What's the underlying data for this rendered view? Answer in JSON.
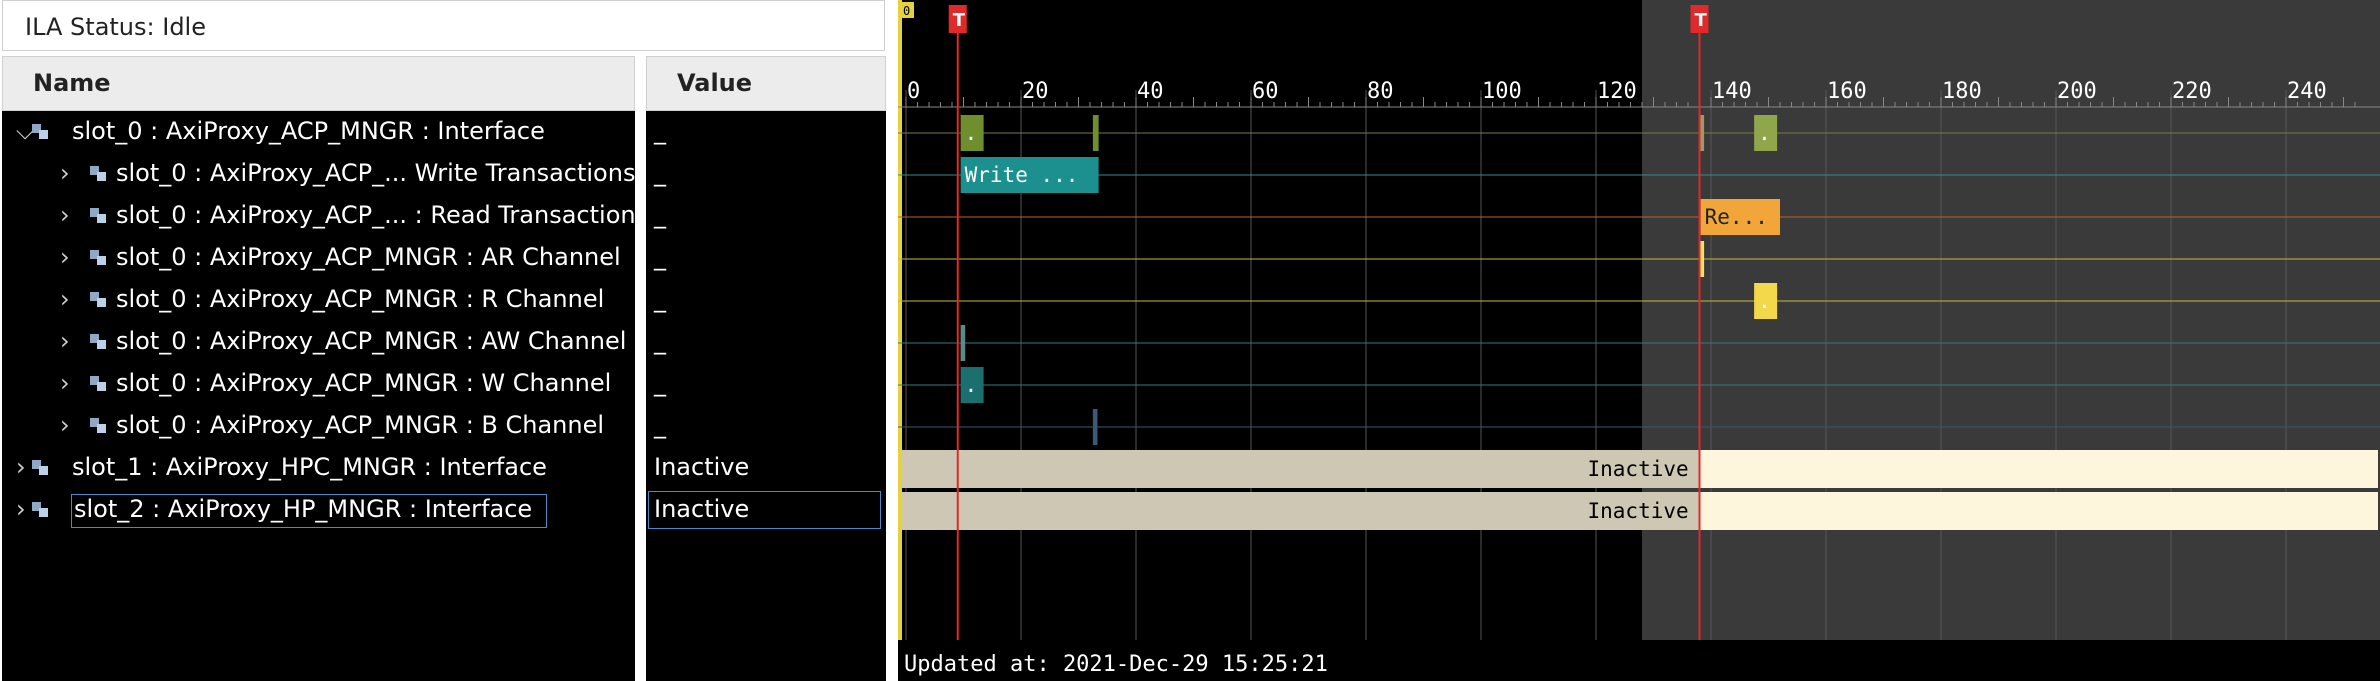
{
  "ila_status": "ILA Status: Idle",
  "columns": {
    "name": "Name",
    "value": "Value"
  },
  "tree": [
    {
      "label": "slot_0 : AxiProxy_ACP_MNGR : Interface",
      "value": "_",
      "expanded": true,
      "level": 0
    },
    {
      "label": "slot_0 : AxiProxy_ACP_... Write Transactions",
      "value": "_",
      "level": 1
    },
    {
      "label": "slot_0 : AxiProxy_ACP_... : Read Transactions",
      "value": "_",
      "level": 1
    },
    {
      "label": "slot_0 : AxiProxy_ACP_MNGR : AR Channel",
      "value": "_",
      "level": 1
    },
    {
      "label": "slot_0 : AxiProxy_ACP_MNGR : R Channel",
      "value": "_",
      "level": 1
    },
    {
      "label": "slot_0 : AxiProxy_ACP_MNGR : AW Channel",
      "value": "_",
      "level": 1
    },
    {
      "label": "slot_0 : AxiProxy_ACP_MNGR : W Channel",
      "value": "_",
      "level": 1
    },
    {
      "label": "slot_0 : AxiProxy_ACP_MNGR : B Channel",
      "value": "_",
      "level": 1
    },
    {
      "label": "slot_1 : AxiProxy_HPC_MNGR : Interface",
      "value": "Inactive",
      "level": 0
    },
    {
      "label": "slot_2 : AxiProxy_HP_MNGR : Interface",
      "value": "Inactive",
      "level": 0,
      "selected": true
    }
  ],
  "waveform": {
    "ticks": [
      "0",
      "20",
      "40",
      "60",
      "80",
      "100",
      "120",
      "140",
      "160",
      "180",
      "200",
      "220",
      "240"
    ],
    "origin_marker": "0",
    "markers": [
      {
        "label": "T",
        "sample": 9
      },
      {
        "label": "T",
        "sample": 138
      }
    ],
    "shade_start_sample": 128,
    "bars": [
      {
        "row": 0,
        "from": 9.5,
        "to": 13.5,
        "color": "#6f8f2f",
        "text": "."
      },
      {
        "row": 0,
        "from": 32.5,
        "to": 33.5,
        "color": "#6f8f2f",
        "text": ""
      },
      {
        "row": 0,
        "from": 138,
        "to": 138.8,
        "color": "#9a9a6a",
        "text": ""
      },
      {
        "row": 0,
        "from": 147.5,
        "to": 151.5,
        "color": "#8fa64a",
        "text": "."
      },
      {
        "row": 1,
        "from": 9.5,
        "to": 33.5,
        "color": "#1c8f8f",
        "text": "Write ..."
      },
      {
        "row": 2,
        "from": 138.2,
        "to": 152,
        "color": "#f2a63a",
        "text": "Re..."
      },
      {
        "row": 3,
        "from": 138,
        "to": 138.8,
        "color": "#f2e36a",
        "text": ""
      },
      {
        "row": 4,
        "from": 147.5,
        "to": 151.5,
        "color": "#f2d84a",
        "text": "."
      },
      {
        "row": 5,
        "from": 9.5,
        "to": 10.3,
        "color": "#5a8a8a",
        "text": ""
      },
      {
        "row": 6,
        "from": 9.5,
        "to": 13.5,
        "color": "#1c6f6f",
        "text": "."
      },
      {
        "row": 7,
        "from": 32.5,
        "to": 33.3,
        "color": "#3a5a7a",
        "text": ""
      }
    ],
    "row_lines": [
      "#7a7a4a",
      "#3a8a8a",
      "#c0602a",
      "#c8b84a",
      "#c8b84a",
      "#3a7a7a",
      "#3a7a7a",
      "#3a5a6a"
    ],
    "inactive_label": "Inactive",
    "updated": "Updated at: 2021-Dec-29 15:25:21"
  }
}
